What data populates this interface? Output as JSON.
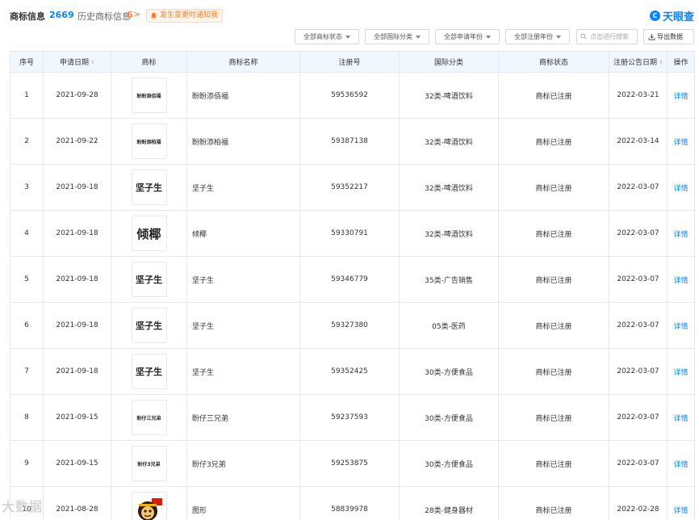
{
  "header": {
    "title": "商标信息",
    "count": "2669",
    "history_label": "历史商标信息",
    "history_count": "6",
    "history_arrow": ">",
    "notify_label": "发生变更时通知我",
    "logo_text": "天眼查",
    "logo_mark": "C"
  },
  "filters": {
    "status": "全部商标状态",
    "intl_class": "全部国际分类",
    "apply_year": "全部申请年份",
    "reg_year": "全部注册年份",
    "search_placeholder": "点击进行搜索",
    "export": "导出数据"
  },
  "table": {
    "columns": [
      "序号",
      "申请日期",
      "商标",
      "商标名称",
      "注册号",
      "国际分类",
      "商标状态",
      "注册公告日期",
      "操作"
    ],
    "rows": [
      {
        "no": "1",
        "date": "2021-09-28",
        "mark": "盼盼添佰福",
        "mark_size": "s",
        "name": "盼盼添佰福",
        "reg": "59536592",
        "cls": "32类-啤酒饮料",
        "status": "商标已注册",
        "pub": "2022-03-21",
        "action": "详情"
      },
      {
        "no": "2",
        "date": "2021-09-22",
        "mark": "盼盼添柏福",
        "mark_size": "s",
        "name": "盼盼添柏福",
        "reg": "59387138",
        "cls": "32类-啤酒饮料",
        "status": "商标已注册",
        "pub": "2022-03-14",
        "action": "详情"
      },
      {
        "no": "3",
        "date": "2021-09-18",
        "mark": "坚子生",
        "mark_size": "m",
        "name": "坚子生",
        "reg": "59352217",
        "cls": "32类-啤酒饮料",
        "status": "商标已注册",
        "pub": "2022-03-07",
        "action": "详情"
      },
      {
        "no": "4",
        "date": "2021-09-18",
        "mark": "倾椰",
        "mark_size": "l",
        "name": "倾椰",
        "reg": "59330791",
        "cls": "32类-啤酒饮料",
        "status": "商标已注册",
        "pub": "2022-03-07",
        "action": "详情"
      },
      {
        "no": "5",
        "date": "2021-09-18",
        "mark": "坚子生",
        "mark_size": "m",
        "name": "坚子生",
        "reg": "59346779",
        "cls": "35类-广告销售",
        "status": "商标已注册",
        "pub": "2022-03-07",
        "action": "详情"
      },
      {
        "no": "6",
        "date": "2021-09-18",
        "mark": "坚子生",
        "mark_size": "m",
        "name": "坚子生",
        "reg": "59327380",
        "cls": "05类-医药",
        "status": "商标已注册",
        "pub": "2022-03-07",
        "action": "详情"
      },
      {
        "no": "7",
        "date": "2021-09-18",
        "mark": "坚子生",
        "mark_size": "m",
        "name": "坚子生",
        "reg": "59352425",
        "cls": "30类-方便食品",
        "status": "商标已注册",
        "pub": "2022-03-07",
        "action": "详情"
      },
      {
        "no": "8",
        "date": "2021-09-15",
        "mark": "盼仔三兄弟",
        "mark_size": "s",
        "name": "盼仔三兄弟",
        "reg": "59237593",
        "cls": "30类-方便食品",
        "status": "商标已注册",
        "pub": "2022-03-07",
        "action": "详情"
      },
      {
        "no": "9",
        "date": "2021-09-15",
        "mark": "盼仔3兄弟",
        "mark_size": "s",
        "name": "盼仔3兄弟",
        "reg": "59253875",
        "cls": "30类-方便食品",
        "status": "商标已注册",
        "pub": "2022-03-07",
        "action": "详情"
      },
      {
        "no": "10",
        "date": "2021-08-28",
        "mark": "",
        "mark_size": "img",
        "name": "图形",
        "reg": "58839978",
        "cls": "28类-健身器材",
        "status": "商标已注册",
        "pub": "2022-02-28",
        "action": "详情"
      }
    ]
  },
  "colors": {
    "accent": "#0084ff",
    "orange": "#ff7a2f",
    "header_bg": "#f0f7ff"
  },
  "watermark": "大数据"
}
